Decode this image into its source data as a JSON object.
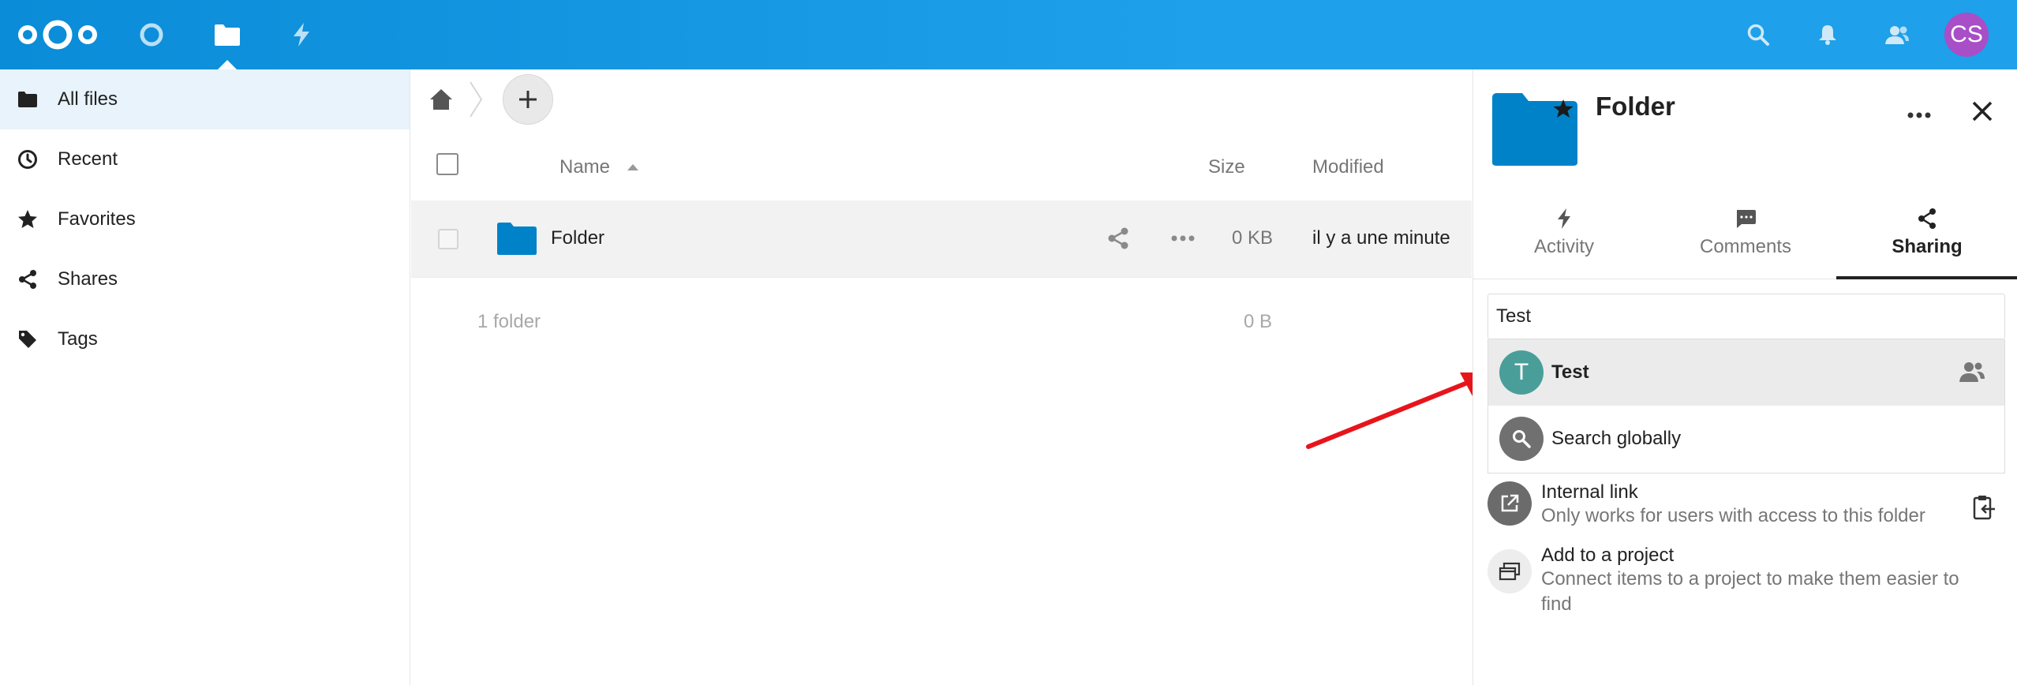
{
  "header": {
    "apps": [
      {
        "name": "Dashboard",
        "icon": "circle-icon"
      },
      {
        "name": "Files",
        "icon": "folder-icon"
      },
      {
        "name": "Activity",
        "icon": "lightning-icon"
      }
    ],
    "user_initials": "CS",
    "avatar_color": "#a84ec7"
  },
  "sidebar": {
    "items": [
      {
        "label": "All files",
        "icon": "folder-icon"
      },
      {
        "label": "Recent",
        "icon": "clock-icon"
      },
      {
        "label": "Favorites",
        "icon": "star-icon"
      },
      {
        "label": "Shares",
        "icon": "share-icon"
      },
      {
        "label": "Tags",
        "icon": "tag-icon"
      }
    ]
  },
  "files": {
    "columns": {
      "name": "Name",
      "size": "Size",
      "modified": "Modified"
    },
    "rows": [
      {
        "name": "Folder",
        "size": "0 KB",
        "modified": "il y a une minute"
      }
    ],
    "summary": {
      "count": "1 folder",
      "size": "0 B"
    }
  },
  "details": {
    "title": "Folder",
    "tabs": [
      {
        "label": "Activity",
        "icon": "lightning-icon"
      },
      {
        "label": "Comments",
        "icon": "comment-icon"
      },
      {
        "label": "Sharing",
        "icon": "share-icon"
      }
    ],
    "share_input_value": "Test",
    "suggestions": [
      {
        "initial": "T",
        "label": "Test",
        "color": "#4a9e9a"
      },
      {
        "label": "Search globally",
        "color": "#707070"
      }
    ],
    "internal_link": {
      "title": "Internal link",
      "subtitle": "Only works for users with access to this folder"
    },
    "project": {
      "title": "Add to a project",
      "subtitle": "Connect items to a project to make them easier to find"
    }
  },
  "colors": {
    "header": "#1ea0ea",
    "folder": "#0082c9",
    "arrow": "#e8141b"
  }
}
